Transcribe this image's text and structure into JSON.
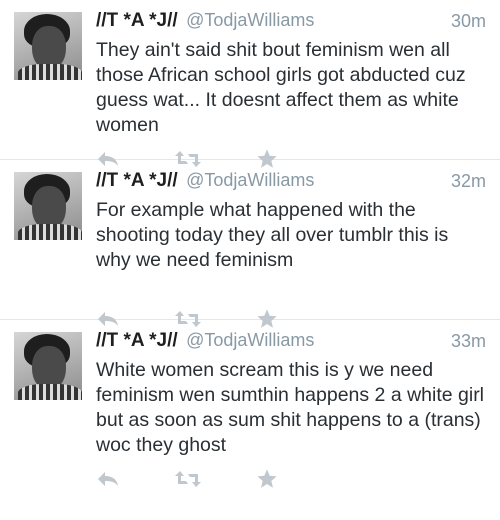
{
  "tweets": [
    {
      "name": "//T *A *J//",
      "handle": "@TodjaWilliams",
      "time": "30m",
      "text": "They ain't said shit bout feminism wen all those African school girls got abducted cuz guess wat... It doesnt affect them as white women"
    },
    {
      "name": "//T *A *J//",
      "handle": "@TodjaWilliams",
      "time": "32m",
      "text": "For example what happened with the shooting today they all over tumblr this is why we need feminism"
    },
    {
      "name": "//T *A *J//",
      "handle": "@TodjaWilliams",
      "time": "33m",
      "text": "White women scream this is y we need feminism wen sumthin happens 2 a white girl but as soon as sum shit happens to a (trans) woc they ghost"
    }
  ],
  "icons": {
    "reply": "reply-icon",
    "retweet": "retweet-icon",
    "favorite": "star-icon"
  },
  "colors": {
    "icon": "#c0c7cd",
    "handle": "#8899a6",
    "text": "#292f33"
  }
}
